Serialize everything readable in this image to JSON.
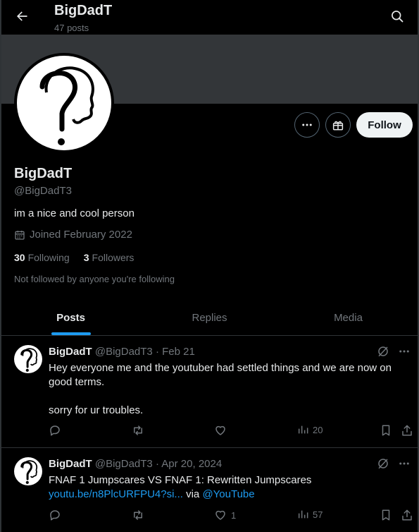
{
  "header": {
    "title": "BigDadT",
    "post_count": "47 posts"
  },
  "profile": {
    "display_name": "BigDadT",
    "handle": "@BigDadT3",
    "bio": "im a nice and cool person",
    "joined": "Joined February 2022",
    "following_count": "30",
    "following_label": "Following",
    "followers_count": "3",
    "followers_label": "Followers",
    "not_followed": "Not followed by anyone you're following",
    "follow_label": "Follow"
  },
  "tabs": [
    {
      "label": "Posts",
      "active": true
    },
    {
      "label": "Replies",
      "active": false
    },
    {
      "label": "Media",
      "active": false
    }
  ],
  "posts": [
    {
      "name": "BigDadT",
      "handle": "@BigDadT3",
      "separator": "·",
      "date": "Feb 21",
      "line1": "Hey everyone me and the youtuber had settled things and we are now on good terms.",
      "line2": "sorry for ur troubles.",
      "replies": "",
      "reposts": "",
      "likes": "",
      "views": "20"
    },
    {
      "name": "BigDadT",
      "handle": "@BigDadT3",
      "separator": "·",
      "date": "Apr 20, 2024",
      "text": "FNAF 1 Jumpscares VS FNAF 1: Rewritten Jumpscares ",
      "link": "youtu.be/n8PlcURFPU4?si...",
      "via": " via ",
      "mention": "@YouTube",
      "replies": "",
      "reposts": "",
      "likes": "1",
      "views": "57"
    }
  ],
  "colors": {
    "background": "#000000",
    "banner": "#333639",
    "accent": "#1d9bf0",
    "text": "#e7e9ea",
    "muted": "#71767b"
  },
  "icons": {
    "back": "arrow-left-icon",
    "search": "search-icon",
    "more": "more-icon",
    "subscribe": "gift-icon",
    "calendar": "calendar-icon",
    "grok": "grok-icon",
    "reply": "reply-icon",
    "repost": "repost-icon",
    "like": "heart-icon",
    "views": "views-icon",
    "bookmark": "bookmark-icon",
    "share": "share-icon"
  }
}
